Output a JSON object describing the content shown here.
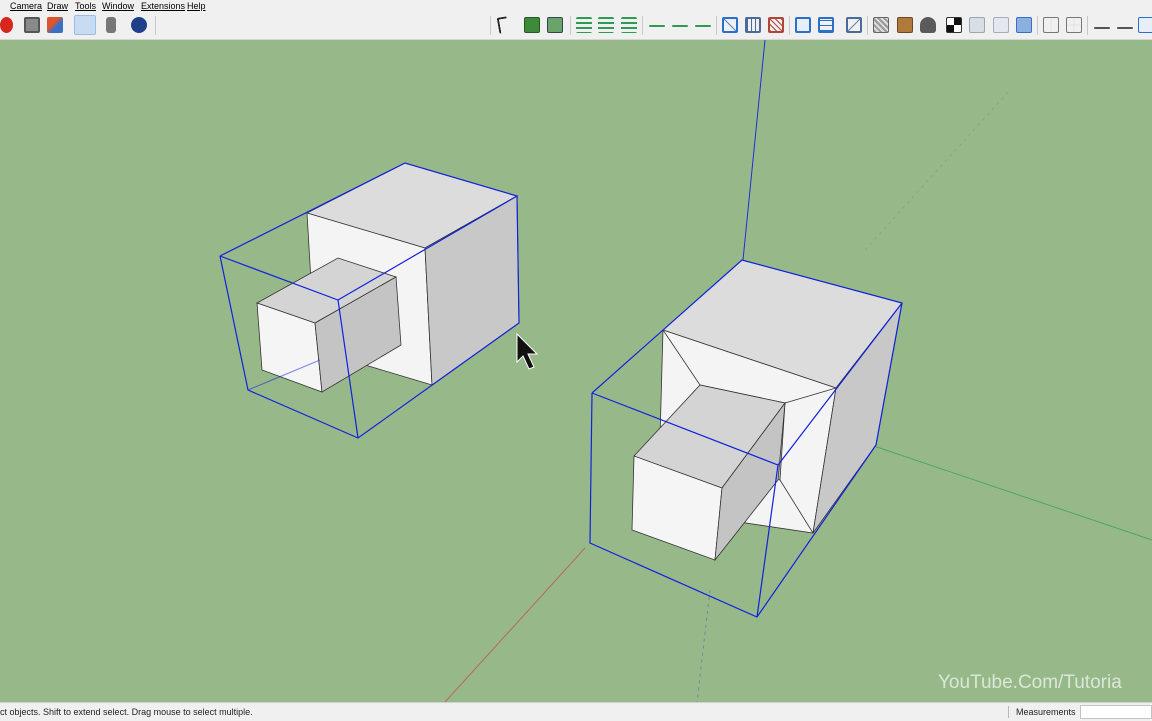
{
  "menu": {
    "items": [
      "Camera",
      "Draw",
      "Tools",
      "Window",
      "Extensions",
      "Help"
    ]
  },
  "toolbar": {
    "icons": [
      "record-icon",
      "erase-icon",
      "paint-icon",
      "orbit-icon",
      "tape-icon",
      "help-icon",
      "select-icon",
      "component-icon",
      "group-icon",
      "layers-align-icon",
      "layers-add-icon",
      "layers-remove-icon",
      "line-thin-icon",
      "line-plus-icon",
      "line-minus-icon",
      "section-icon",
      "section-grid-icon",
      "section-cross-icon",
      "display-icon",
      "display-grid-icon",
      "fill-icon",
      "texture-icon",
      "material-icon",
      "camera-icon",
      "checker-icon",
      "sandbox-icon",
      "flip-icon",
      "transfer-icon",
      "panel-icon",
      "grid-icon",
      "dash-icon",
      "close-icon",
      "split-icon"
    ]
  },
  "status": {
    "hint": "ct objects. Shift to extend select. Drag mouse to select multiple.",
    "measurements_label": "Measurements",
    "measurements_value": ""
  },
  "watermark": "YouTube.Com/Tutoria",
  "colors": {
    "ground": "#97b98a",
    "selection": "#1122dd",
    "face_top": "#dcdcdc",
    "face_front": "#f4f4f4",
    "face_side": "#c6c6c6"
  }
}
